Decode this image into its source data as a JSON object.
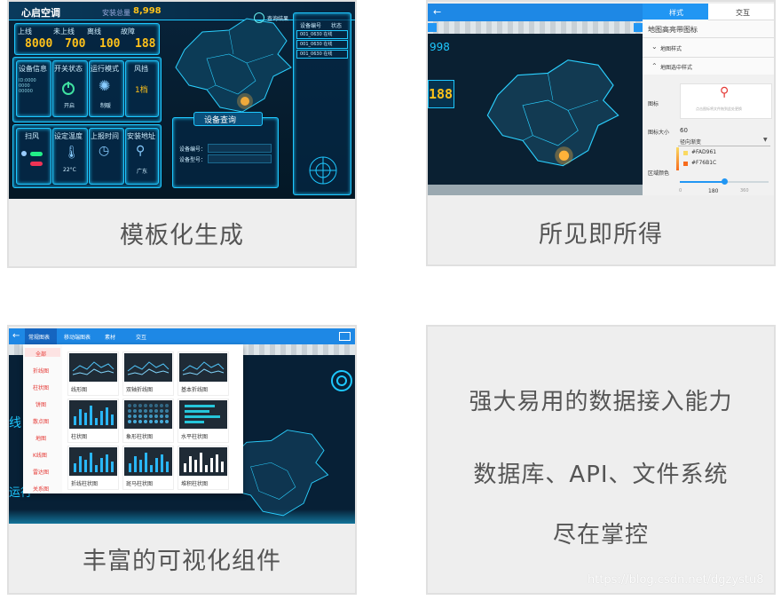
{
  "colors": {
    "accent": "#1ec8ff",
    "brand_blue": "#2196f3",
    "gold": "#ffc21a",
    "card_bg": "#eeeeee"
  },
  "card1": {
    "caption": "模板化生成",
    "title": "心启空调",
    "total_label": "安装总量",
    "total_value": "8,998",
    "search_button": "查询结果",
    "stats": [
      {
        "label": "上线",
        "value": "8000"
      },
      {
        "label": "未上线",
        "value": "700"
      },
      {
        "label": "离线",
        "value": "100"
      },
      {
        "label": "故障",
        "value": "188"
      }
    ],
    "table_headers": [
      "设备编号",
      "状态"
    ],
    "table_rows": [
      "001_0630 在线",
      "001_0630 在线",
      "001_0630 在线"
    ],
    "tiles": [
      {
        "label": "设备信息",
        "icon": "info-icon"
      },
      {
        "label": "开关状态",
        "icon": "power-icon",
        "sub": "开启"
      },
      {
        "label": "运行模式",
        "icon": "sun-icon",
        "sub": "制暖"
      },
      {
        "label": "风挡",
        "icon": "fan-icon",
        "sub": "1档"
      },
      {
        "label": "扫风",
        "icon": "swing-icon"
      },
      {
        "label": "设定温度",
        "icon": "thermometer-icon",
        "sub": "22°C"
      },
      {
        "label": "上报时间",
        "icon": "clock-icon"
      },
      {
        "label": "安装地址",
        "icon": "location-icon",
        "sub": "广东"
      }
    ],
    "query_title": "设备查询",
    "query_fields": [
      "设备编号：",
      "设备型号："
    ]
  },
  "card2": {
    "caption": "所见即所得",
    "partial_number": "998",
    "stat_number": "188",
    "tabs": [
      "样式",
      "交互"
    ],
    "panel_title": "地图高亮带图标",
    "sections": [
      "地图样式",
      "地图选中样式"
    ],
    "icon_label": "图标",
    "icon_hint": "点击图标将文件拖到此处更换",
    "size_label": "图标大小",
    "size_value": "60",
    "gradient_select": "径向渐变",
    "color_stops": [
      "#FAD961",
      "#F76B1C"
    ],
    "region_color_label": "区域颜色",
    "slider_ticks": [
      "0",
      "180",
      "360"
    ]
  },
  "card3": {
    "caption": "丰富的可视化组件",
    "tabs": [
      "常规图表",
      "移动端图表",
      "素材",
      "交互"
    ],
    "categories": [
      "全部",
      "折线图",
      "柱状图",
      "饼图",
      "散点图",
      "地图",
      "K线图",
      "雷达图",
      "关系图"
    ],
    "components": [
      "线形图",
      "双轴折线图",
      "基本折线图",
      "柱状图",
      "象形柱状图",
      "水平柱状图",
      "折线柱状图",
      "斑马柱状图",
      "堆积柱状图"
    ],
    "side_texts": [
      "线",
      "运行"
    ]
  },
  "card4": {
    "lines": [
      "强大易用的数据接入能力",
      "数据库、API、文件系统",
      "尽在掌控"
    ]
  },
  "watermark": "https://blog.csdn.net/dgzystu8"
}
